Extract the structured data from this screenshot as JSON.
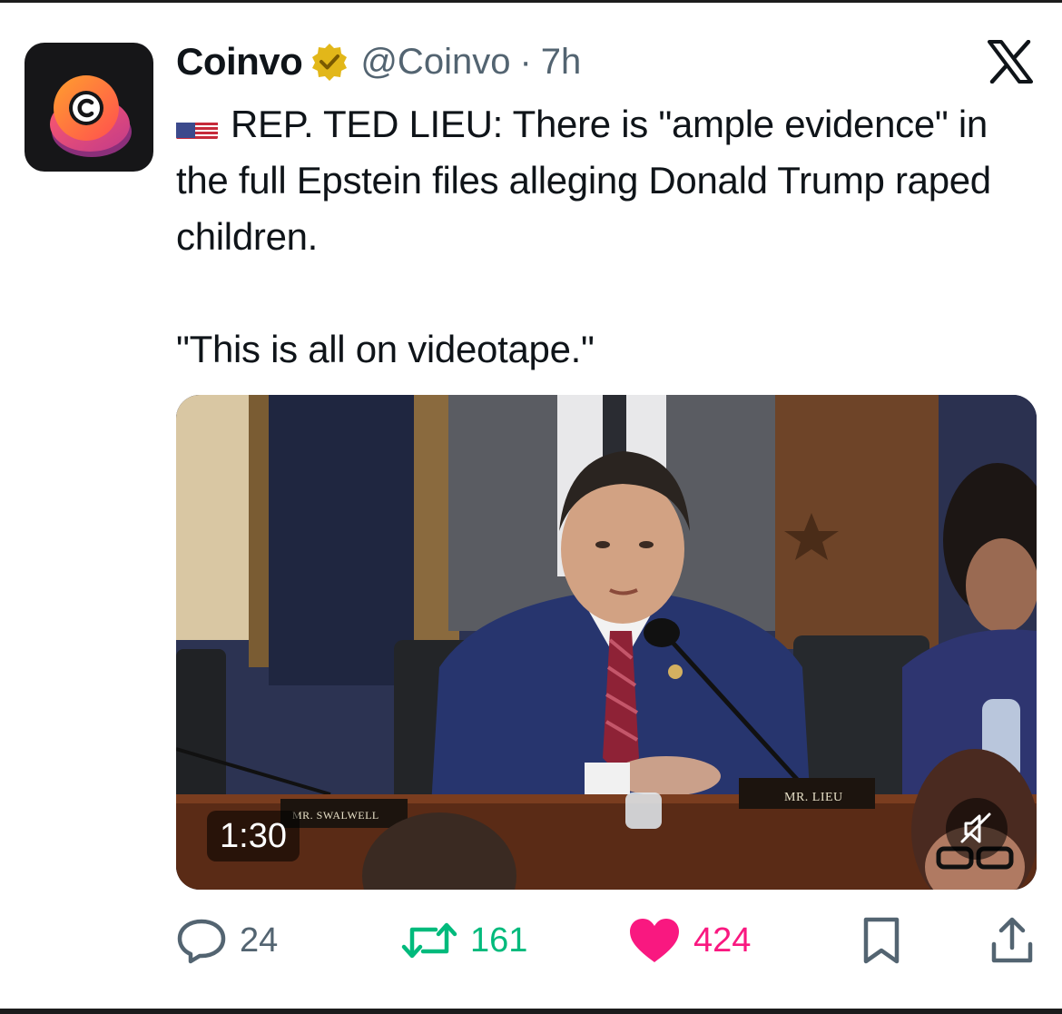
{
  "author": {
    "name": "Coinvo",
    "handle": "@Coinvo",
    "separator": "·",
    "time": "7h",
    "verified_badge": "gold-verified-icon",
    "avatar_letter": "C"
  },
  "platform_logo": "x-logo-icon",
  "tweet": {
    "flag": "us-flag-icon",
    "line1": "REP. TED LIEU: There is \"ample evidence\" in the full Epstein files alleging Donald Trump raped children.",
    "line2": "\"This is all on videotape.\""
  },
  "media": {
    "duration": "1:30",
    "mute_icon": "muted-speaker-icon",
    "nameplate_main": "MR. LIEU",
    "nameplate_left": "MR. SWALWELL"
  },
  "actions": {
    "replies": "24",
    "retweets": "161",
    "likes": "424",
    "bookmark_icon": "bookmark-icon",
    "share_icon": "share-icon"
  },
  "colors": {
    "text_primary": "#0f1419",
    "text_secondary": "#536471",
    "retweet_green": "#00ba7c",
    "like_pink": "#f91880",
    "verified_gold": "#e2b719"
  }
}
